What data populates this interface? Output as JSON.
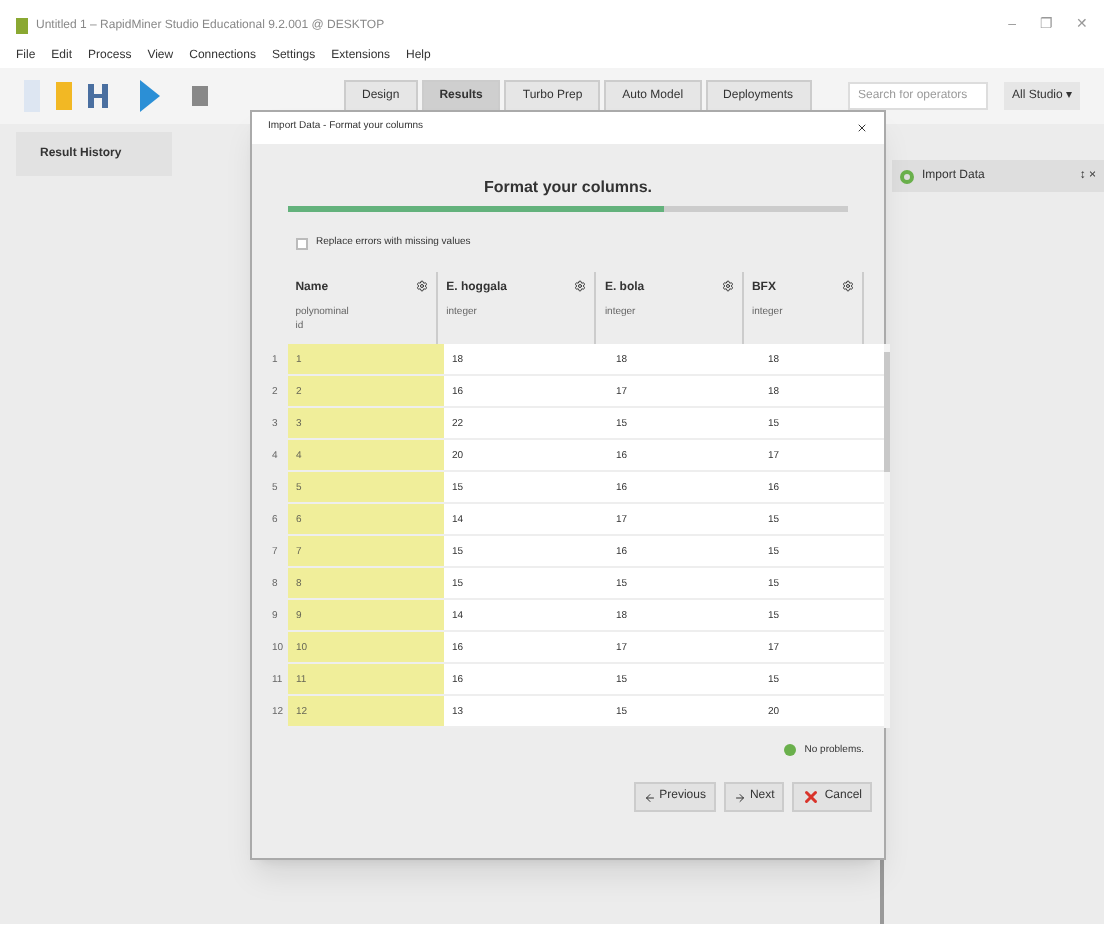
{
  "window": {
    "title": "Untitled 1 – RapidMiner Studio Educational 9.2.001 @ DESKTOP",
    "controls": [
      "–",
      "❐",
      "✕"
    ]
  },
  "menu": [
    "File",
    "Edit",
    "Process",
    "View",
    "Connections",
    "Settings",
    "Extensions",
    "Help"
  ],
  "perspectives": [
    {
      "label": "Design",
      "selected": false
    },
    {
      "label": "Results",
      "selected": true
    },
    {
      "label": "Turbo Prep",
      "selected": false
    },
    {
      "label": "Auto Model",
      "selected": false
    },
    {
      "label": "Deployments",
      "selected": false
    }
  ],
  "search": {
    "placeholder": "Search for operators"
  },
  "studio_menu": "All Studio ▾",
  "left_panel": {
    "title": "Result History"
  },
  "right_panel": {
    "title": "Import Data",
    "controls": "↕ ×"
  },
  "dialog": {
    "title": "Import Data - Format your columns",
    "heading": "Format your columns.",
    "progress": {
      "level": 0.67
    },
    "replace_errors": {
      "label": "Replace errors with missing values",
      "checked": false
    },
    "columns": [
      {
        "name": "Name",
        "type": "polynominal",
        "role": "id"
      },
      {
        "name": "E. hoggala",
        "type": "integer"
      },
      {
        "name": "E. bola",
        "type": "integer"
      },
      {
        "name": "BFX",
        "type": "integer"
      }
    ],
    "rows": [
      {
        "num": "1",
        "cells": [
          "1",
          "18",
          "18",
          "18"
        ]
      },
      {
        "num": "2",
        "cells": [
          "2",
          "16",
          "17",
          "18"
        ]
      },
      {
        "num": "3",
        "cells": [
          "3",
          "22",
          "15",
          "15"
        ]
      },
      {
        "num": "4",
        "cells": [
          "4",
          "20",
          "16",
          "17"
        ]
      },
      {
        "num": "5",
        "cells": [
          "5",
          "15",
          "16",
          "16"
        ]
      },
      {
        "num": "6",
        "cells": [
          "6",
          "14",
          "17",
          "15"
        ]
      },
      {
        "num": "7",
        "cells": [
          "7",
          "15",
          "16",
          "15"
        ]
      },
      {
        "num": "8",
        "cells": [
          "8",
          "15",
          "15",
          "15"
        ]
      },
      {
        "num": "9",
        "cells": [
          "9",
          "14",
          "18",
          "15"
        ]
      },
      {
        "num": "10",
        "cells": [
          "10",
          "16",
          "17",
          "17"
        ]
      },
      {
        "num": "11",
        "cells": [
          "11",
          "16",
          "15",
          "15"
        ]
      },
      {
        "num": "12",
        "cells": [
          "12",
          "13",
          "15",
          "20"
        ]
      }
    ],
    "status": "No problems.",
    "buttons": [
      {
        "kind": "previous",
        "label": "Previous"
      },
      {
        "kind": "next",
        "label": "Next"
      },
      {
        "kind": "cancel",
        "label": "Cancel"
      }
    ]
  }
}
